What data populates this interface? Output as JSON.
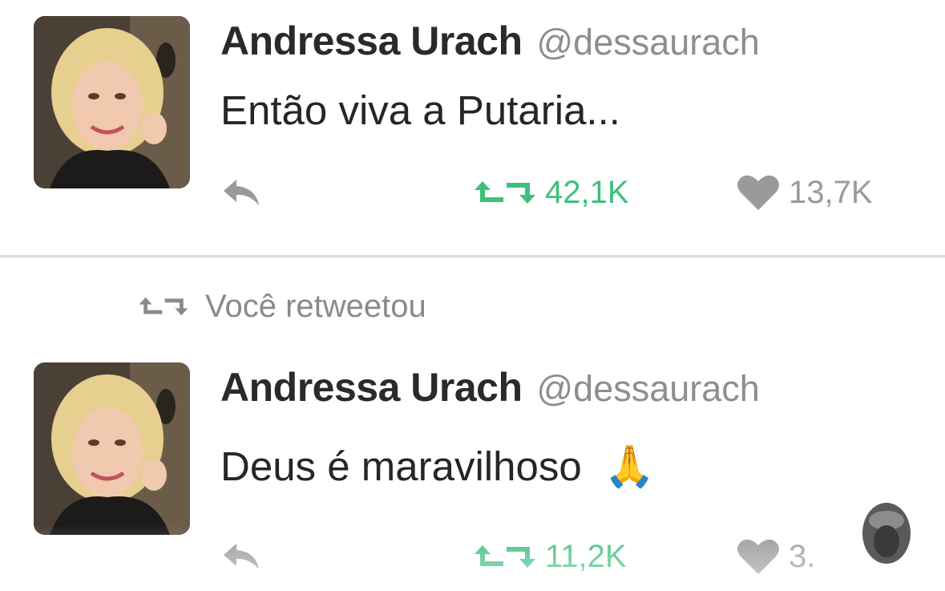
{
  "tweets": [
    {
      "name": "Andressa Urach",
      "handle": "@dessaurach",
      "text": "Então viva a Putaria...",
      "emoji": "",
      "retweets": "42,1K",
      "likes": "13,7K"
    },
    {
      "retweeted_by_label": "Você retweetou",
      "name": "Andressa Urach",
      "handle": "@dessaurach",
      "text": "Deus é maravilhoso",
      "emoji": "🙏",
      "retweets": "11,2K",
      "likes": "3."
    }
  ],
  "colors": {
    "retweet_active": "#3fbf7c",
    "icon_grey": "#9a9a9a",
    "divider": "#dcdcdc"
  },
  "icons": {
    "reply": "reply-icon",
    "retweet": "retweet-icon",
    "like": "heart-icon",
    "avatar": "profile-photo",
    "watermark": "watermark-logo"
  }
}
